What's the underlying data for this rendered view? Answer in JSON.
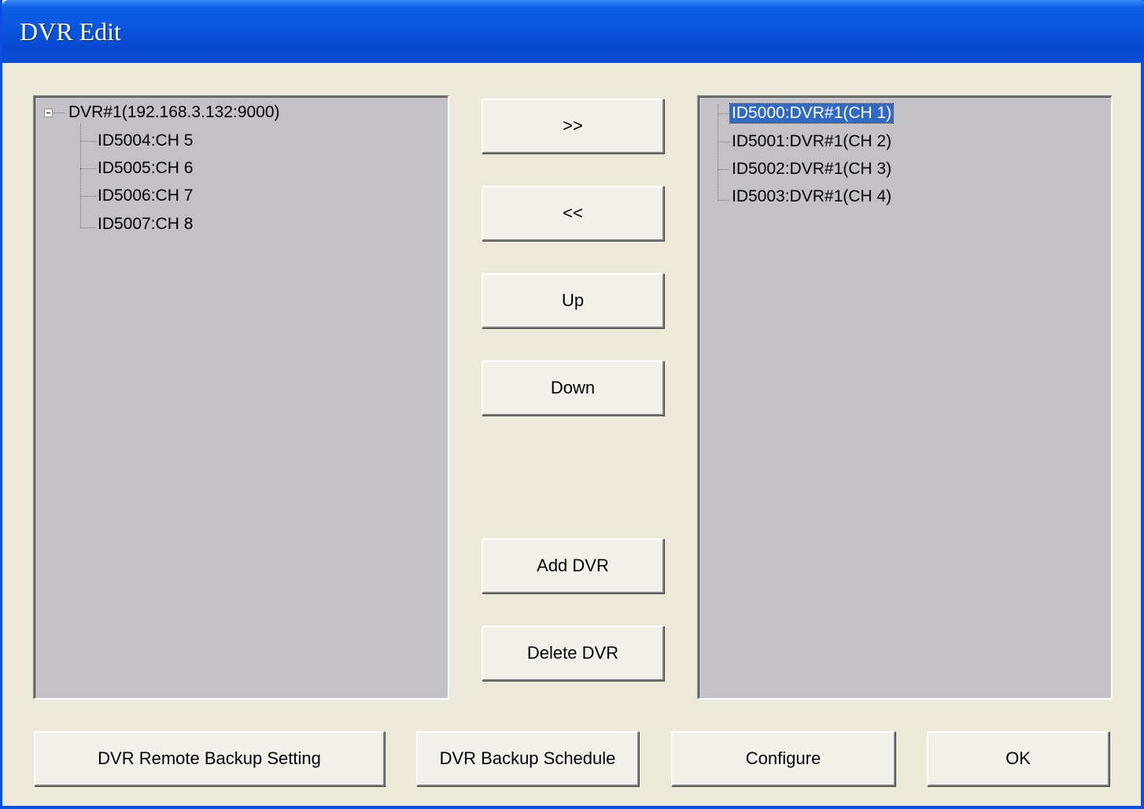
{
  "window": {
    "title": "DVR Edit"
  },
  "left_tree": {
    "root_label": "DVR#1(192.168.3.132:9000)",
    "children": [
      "ID5004:CH 5",
      "ID5005:CH 6",
      "ID5006:CH 7",
      "ID5007:CH 8"
    ]
  },
  "right_tree": {
    "items": [
      "ID5000:DVR#1(CH 1)",
      "ID5001:DVR#1(CH 2)",
      "ID5002:DVR#1(CH 3)",
      "ID5003:DVR#1(CH 4)"
    ],
    "selected_index": 0
  },
  "middle_buttons": {
    "add": ">>",
    "remove": "<<",
    "up": "Up",
    "down": "Down",
    "add_dvr": "Add DVR",
    "delete_dvr": "Delete DVR"
  },
  "bottom_buttons": {
    "remote_backup": "DVR Remote Backup Setting",
    "backup_schedule": "DVR Backup Schedule",
    "configure": "Configure",
    "ok": "OK"
  }
}
